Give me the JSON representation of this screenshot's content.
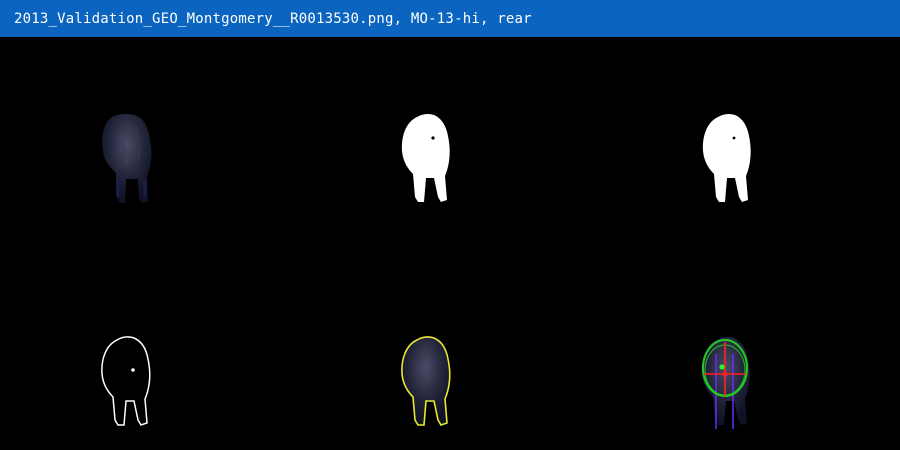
{
  "window": {
    "title": "2013_Validation_GEO_Montgomery__R0013530.png, MO-13-hi, rear"
  },
  "colors": {
    "titlebar": "#0a64c0",
    "background": "#000000",
    "mask": "#ffffff",
    "contour": "#ffffff",
    "overlay_contour": "#e8e830",
    "ellipse": "#22cc22",
    "axis_major": "#ff2020",
    "axis_minor": "#ff2020",
    "centroid": "#22ff22",
    "vertical_guides": "#6a2cff",
    "animal_tone": "#2a2c44"
  },
  "panels": [
    {
      "name": "original-image",
      "icon": "cow-rear-photo"
    },
    {
      "name": "binary-mask",
      "icon": "cow-rear-mask"
    },
    {
      "name": "cleaned-mask",
      "icon": "cow-rear-mask-filled"
    },
    {
      "name": "contour-outline",
      "icon": "cow-rear-contour"
    },
    {
      "name": "contour-overlay",
      "icon": "cow-rear-contour-overlay"
    },
    {
      "name": "ellipse-fit",
      "icon": "cow-rear-ellipse-fit"
    }
  ]
}
